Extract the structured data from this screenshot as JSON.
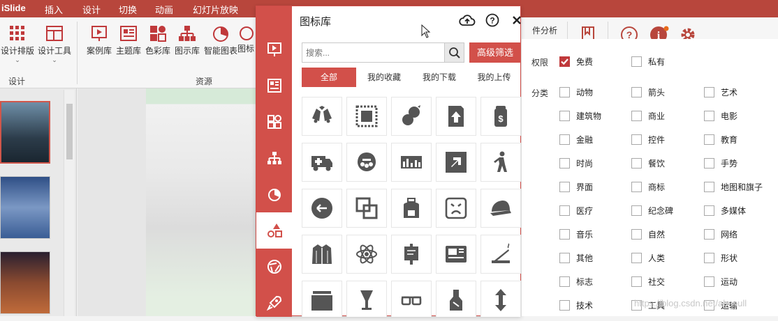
{
  "ribbon_tabs": [
    "iSlide",
    "插入",
    "设计",
    "切换",
    "动画",
    "幻灯片放映"
  ],
  "ribbon": {
    "design_group": {
      "label": "设计",
      "buttons": [
        "设计排版",
        "设计工具"
      ]
    },
    "resource_group": {
      "label": "资源",
      "buttons": [
        "案例库",
        "主题库",
        "色彩库",
        "图示库",
        "智能图表",
        "图标"
      ]
    },
    "analysis_label": "件分析"
  },
  "panel": {
    "title": "图标库",
    "search_placeholder": "搜索...",
    "advanced_filter": "高级筛选",
    "tabs": [
      "全部",
      "我的收藏",
      "我的下载",
      "我的上传"
    ],
    "icons": [
      "bells-icon",
      "frame-icon",
      "grapes-icon",
      "export-file-icon",
      "money-bag-icon",
      "ambulance-icon",
      "alien-icon",
      "cityscape-icon",
      "arrow-box-icon",
      "walker-icon",
      "arrow-left-circle-icon",
      "overlap-squares-icon",
      "backpack-icon",
      "sad-face-icon",
      "cap-icon",
      "jacket-icon",
      "atom-icon",
      "scroll-icon",
      "id-card-icon",
      "incense-icon",
      "box-icon",
      "goblet-icon",
      "glasses-icon",
      "bottle-icon",
      "updown-arrow-icon"
    ]
  },
  "filter": {
    "permission_label": "权限",
    "permissions": [
      {
        "label": "免费",
        "checked": true
      },
      {
        "label": "私有",
        "checked": false
      }
    ],
    "category_label": "分类",
    "categories": [
      "动物",
      "箭头",
      "艺术",
      "建筑物",
      "商业",
      "电影",
      "金融",
      "控件",
      "教育",
      "时尚",
      "餐饮",
      "手势",
      "界面",
      "商标",
      "地图和旗子",
      "医疗",
      "纪念碑",
      "多媒体",
      "音乐",
      "自然",
      "网络",
      "其他",
      "人类",
      "形状",
      "标志",
      "社交",
      "运动",
      "技术",
      "工具",
      "运输"
    ]
  },
  "watermark": "https://blog.csdn.net/abcnull",
  "colors": {
    "brand": "#d2504a",
    "ribbon": "#b8463c",
    "check": "#c0393b"
  }
}
